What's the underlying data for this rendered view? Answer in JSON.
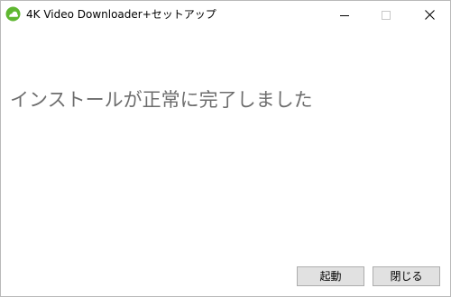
{
  "window": {
    "title": "4K Video Downloader+セットアップ",
    "app_icon": "4k-video-downloader-icon"
  },
  "title_controls": {
    "minimize_icon": "minimize-icon",
    "maximize_icon": "maximize-icon",
    "close_icon": "close-icon"
  },
  "main": {
    "headline": "インストールが正常に完了しました"
  },
  "buttons": {
    "launch_label": "起動",
    "close_label": "閉じる"
  },
  "colors": {
    "headline_text": "#6d6d6d",
    "button_face": "#e1e1e1",
    "button_border": "#adadad",
    "icon_green": "#5fb731"
  }
}
